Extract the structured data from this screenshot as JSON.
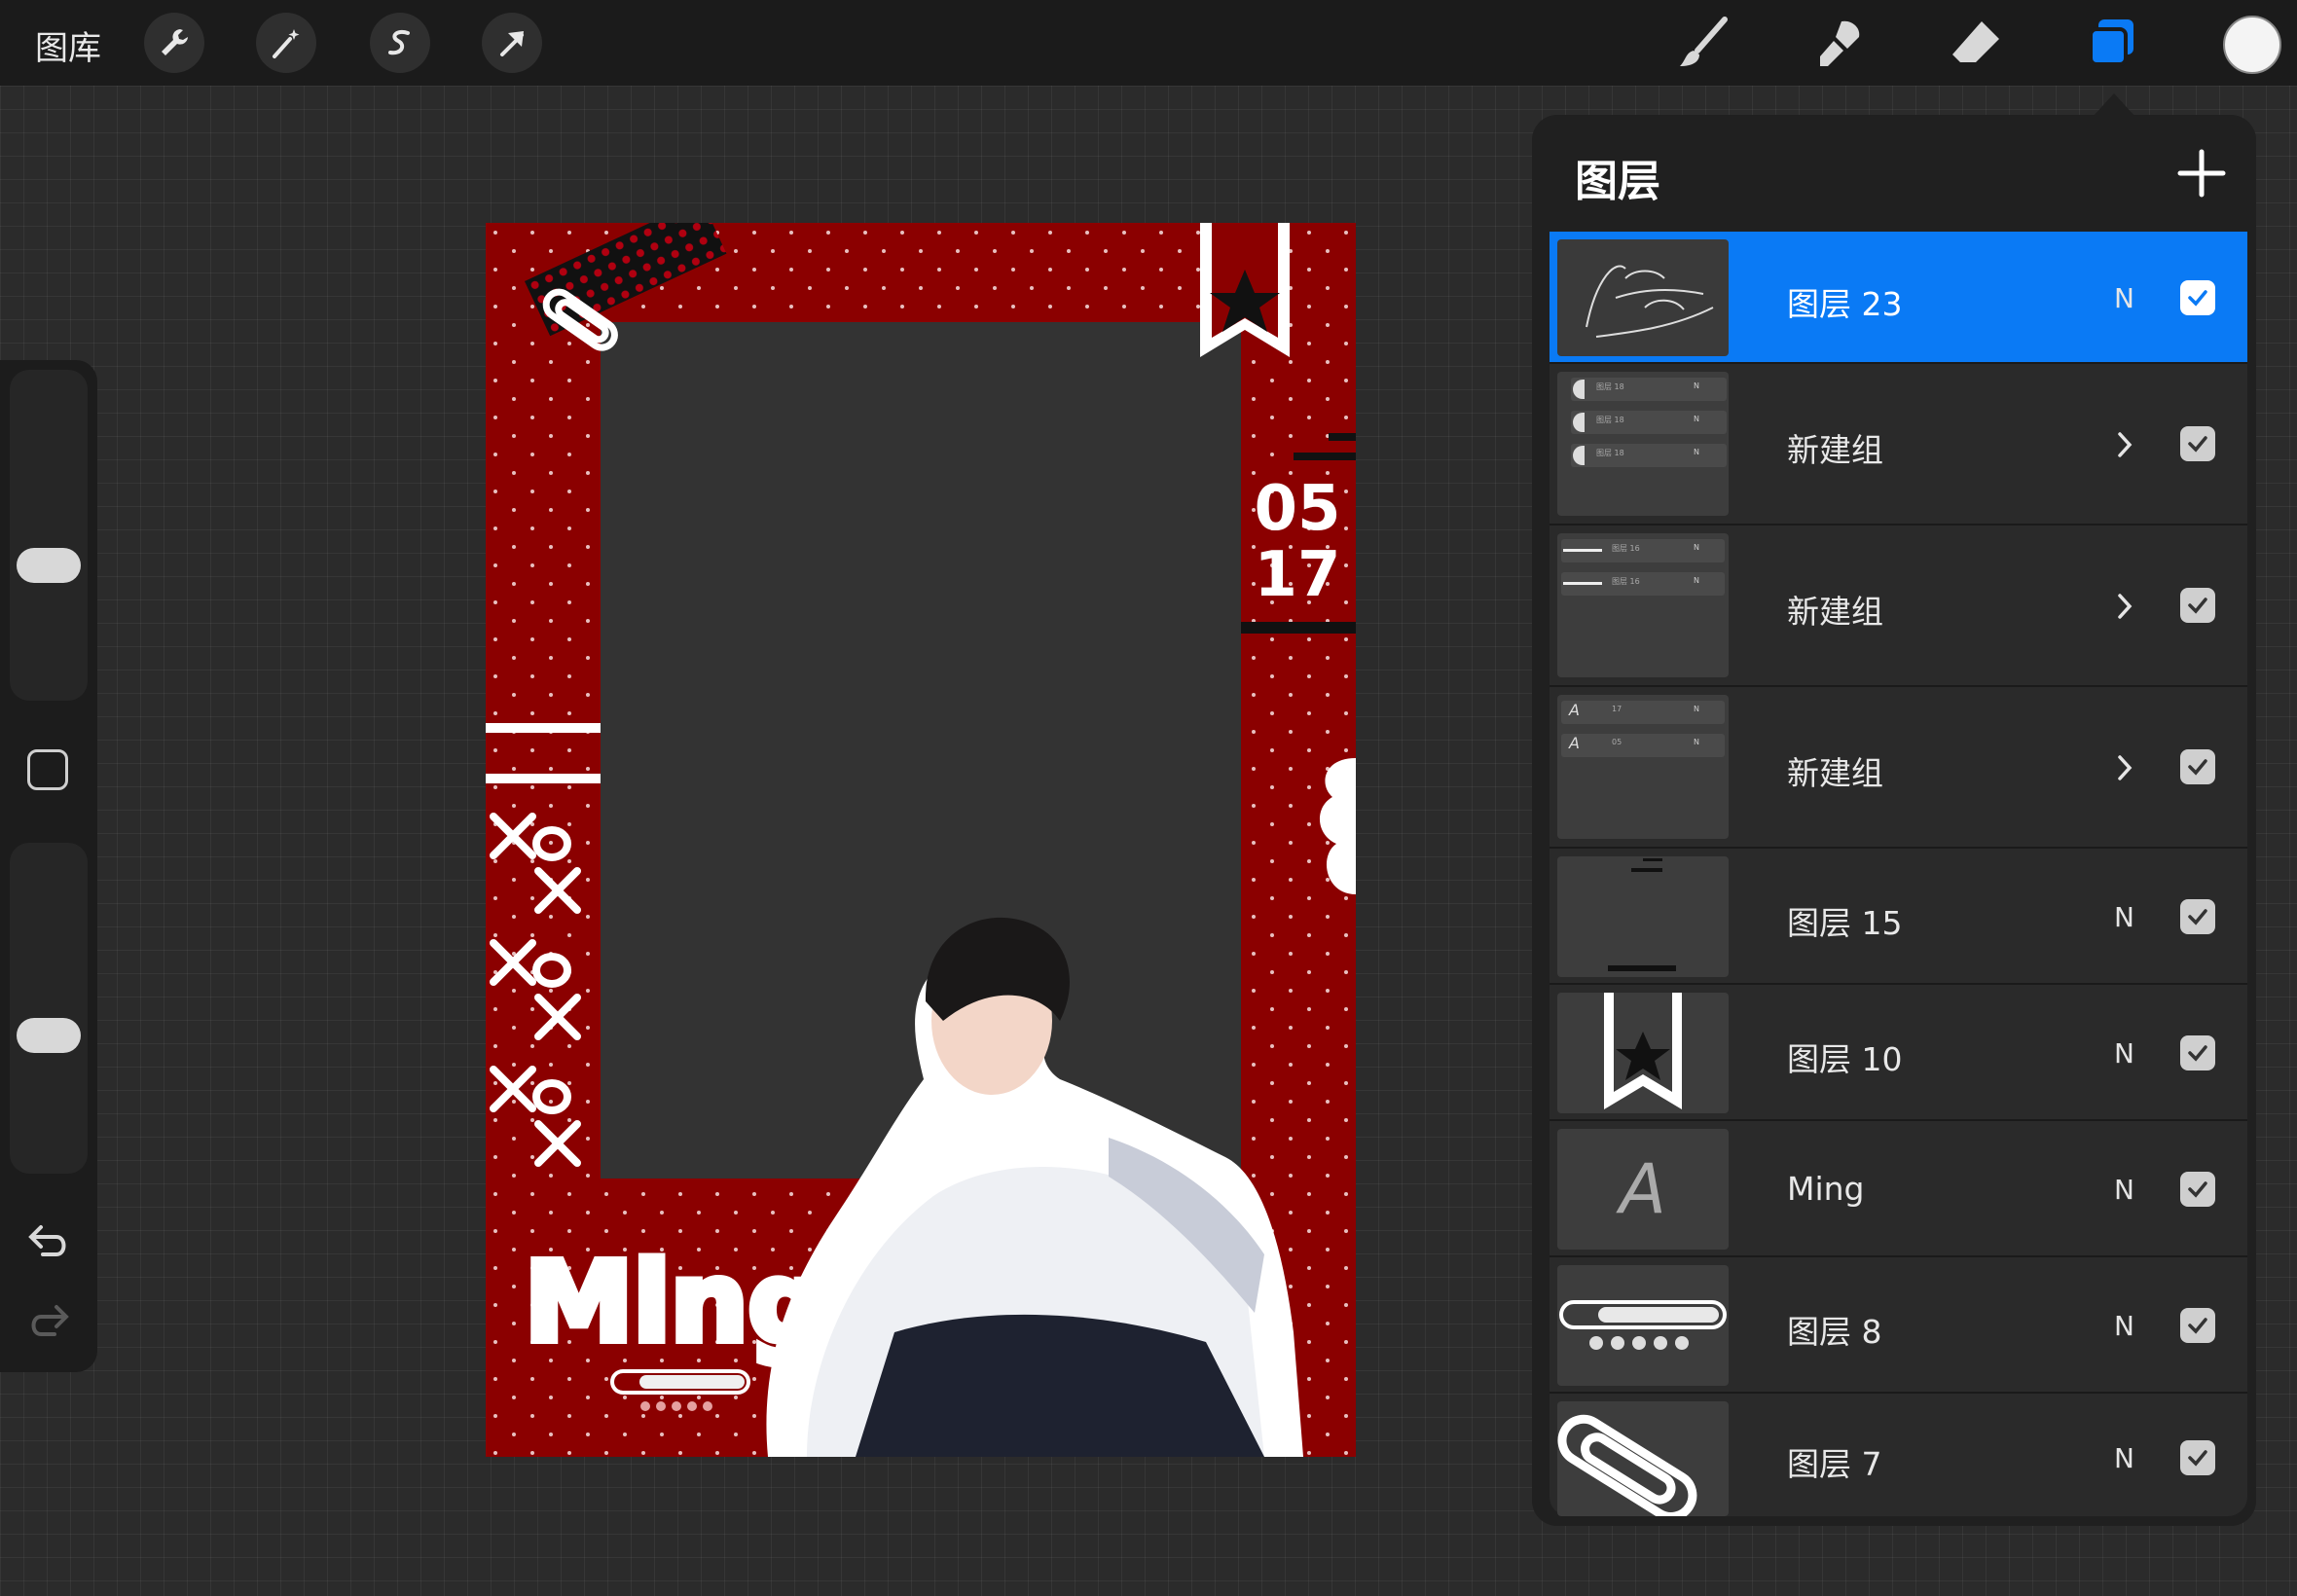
{
  "topbar": {
    "gallery_label": "图库",
    "left_tools": [
      "wrench-icon",
      "magic-wand-icon",
      "selection-icon",
      "transform-arrow-icon"
    ],
    "right_tools": [
      "brush-icon",
      "smudge-icon",
      "eraser-icon",
      "layers-icon"
    ],
    "active_color": "#ffffff",
    "accent_color": "#0a7af5"
  },
  "artwork": {
    "name_text": "Ming",
    "date_month": "05",
    "date_day": "17",
    "frame_color": "#8b0000"
  },
  "layers_panel": {
    "title": "图层",
    "layers": [
      {
        "name": "图层 23",
        "mode": "N",
        "visible": true,
        "active": true,
        "is_group": false
      },
      {
        "name": "新建组",
        "visible": true,
        "active": false,
        "is_group": true,
        "thumb_rows": [
          "图层 18",
          "图层 18",
          "图层 18"
        ],
        "thumb_mode": "N"
      },
      {
        "name": "新建组",
        "visible": true,
        "active": false,
        "is_group": true,
        "thumb_rows": [
          "图层 16",
          "图层 16"
        ],
        "thumb_mode": "N"
      },
      {
        "name": "新建组",
        "visible": true,
        "active": false,
        "is_group": true,
        "thumb_rows": [
          "17",
          "05"
        ],
        "thumb_mode": "N"
      },
      {
        "name": "图层 15",
        "mode": "N",
        "visible": true,
        "active": false,
        "is_group": false
      },
      {
        "name": "图层 10",
        "mode": "N",
        "visible": true,
        "active": false,
        "is_group": false
      },
      {
        "name": "Ming",
        "mode": "N",
        "visible": true,
        "active": false,
        "is_group": false,
        "thumb_letter": "A"
      },
      {
        "name": "图层 8",
        "mode": "N",
        "visible": true,
        "active": false,
        "is_group": false
      },
      {
        "name": "图层 7",
        "mode": "N",
        "visible": true,
        "active": false,
        "is_group": false
      }
    ]
  }
}
